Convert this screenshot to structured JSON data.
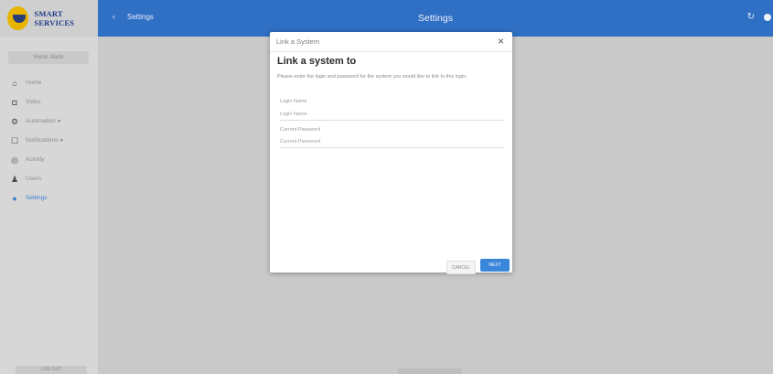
{
  "brand": {
    "name": "SMART SERVICES"
  },
  "sidebar": {
    "home_chip": "Home Alarm",
    "items": [
      {
        "label": "Home",
        "icon": "home-icon",
        "glyph": "⌂"
      },
      {
        "label": "Video",
        "icon": "video-icon",
        "glyph": "◘"
      },
      {
        "label": "Automation ●",
        "icon": "automation-icon",
        "glyph": "⚙"
      },
      {
        "label": "Notifications ●",
        "icon": "notifications-icon",
        "glyph": "☐"
      },
      {
        "label": "Activity",
        "icon": "activity-icon",
        "glyph": "◎"
      },
      {
        "label": "Users",
        "icon": "users-icon",
        "glyph": "♟"
      },
      {
        "label": "Settings",
        "icon": "settings-icon",
        "glyph": "●",
        "active": true
      }
    ],
    "logout": "LOG OUT"
  },
  "topbar": {
    "back_glyph": "‹",
    "back_label": "Settings",
    "title": "Settings",
    "refresh_glyph": "↻"
  },
  "dialog": {
    "header": "Link a System",
    "close_glyph": "×",
    "title": "Link a system to",
    "description": "Please enter the login and password for the system you would like to link to this login.",
    "login": {
      "label": "Login Name",
      "placeholder": "Login Name"
    },
    "password": {
      "label": "Current Password",
      "placeholder": "Current Password"
    },
    "cancel_label": "CANCEL",
    "next_label": "NEXT"
  },
  "colors": {
    "accent": "#2f6fc4",
    "button": "#3a86db",
    "brand_text": "#1d3b8a",
    "logo": "#e8b400"
  }
}
